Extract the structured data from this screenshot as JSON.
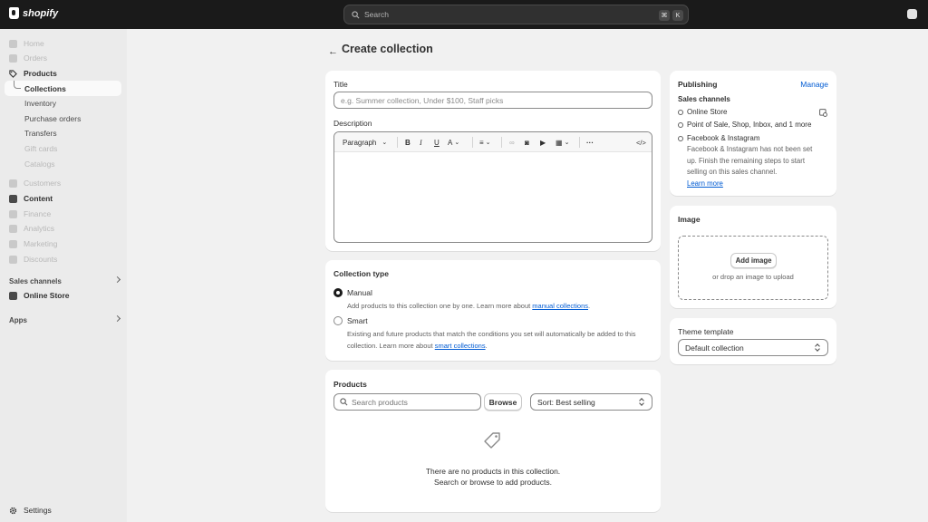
{
  "topbar": {
    "brand": "shopify",
    "search_placeholder": "Search",
    "shortcut_key1": "⌘",
    "shortcut_key2": "K"
  },
  "sidebar": {
    "items": [
      {
        "label": "Home"
      },
      {
        "label": "Orders"
      },
      {
        "label": "Products"
      },
      {
        "label": "Collections"
      },
      {
        "label": "Inventory"
      },
      {
        "label": "Purchase orders"
      },
      {
        "label": "Transfers"
      },
      {
        "label": "Gift cards"
      },
      {
        "label": "Catalogs"
      },
      {
        "label": "Customers"
      },
      {
        "label": "Content"
      },
      {
        "label": "Finance"
      },
      {
        "label": "Analytics"
      },
      {
        "label": "Marketing"
      },
      {
        "label": "Discounts"
      }
    ],
    "sales_channels_label": "Sales channels",
    "online_store": "Online Store",
    "apps_label": "Apps",
    "settings": "Settings"
  },
  "page": {
    "title": "Create collection"
  },
  "title_card": {
    "title_label": "Title",
    "title_placeholder": "e.g. Summer collection, Under $100, Staff picks",
    "description_label": "Description",
    "toolbar_paragraph": "Paragraph"
  },
  "collection_type": {
    "heading": "Collection type",
    "manual_label": "Manual",
    "manual_help": "Add products to this collection one by one. Learn more about ",
    "manual_link": "manual collections",
    "manual_tail": ".",
    "smart_label": "Smart",
    "smart_help_line1": "Existing and future products that match the conditions you set will automatically be added to this",
    "smart_help_line2": "collection. Learn more about ",
    "smart_link": "smart collections",
    "smart_tail": ".",
    "selected": "manual"
  },
  "products": {
    "heading": "Products",
    "search_placeholder": "Search products",
    "browse_label": "Browse",
    "sort_value": "Sort: Best selling",
    "empty_line1": "There are no products in this collection.",
    "empty_line2": "Search or browse to add products."
  },
  "publishing": {
    "heading": "Publishing",
    "manage_label": "Manage",
    "sales_channels_label": "Sales channels",
    "channels": [
      {
        "name": "Online Store"
      },
      {
        "name": "Point of Sale, Shop, Inbox, and 1 more"
      },
      {
        "name": "Facebook & Instagram"
      }
    ],
    "fb_note_line1": "Facebook & Instagram has not been set",
    "fb_note_line2": "up. Finish the remaining steps to start",
    "fb_note_line3": "selling on this sales channel.",
    "learn_more": "Learn more"
  },
  "image": {
    "heading": "Image",
    "add_image_label": "Add image",
    "drop_text": "or drop an image to upload"
  },
  "theme": {
    "heading": "Theme template",
    "selected": "Default collection"
  }
}
